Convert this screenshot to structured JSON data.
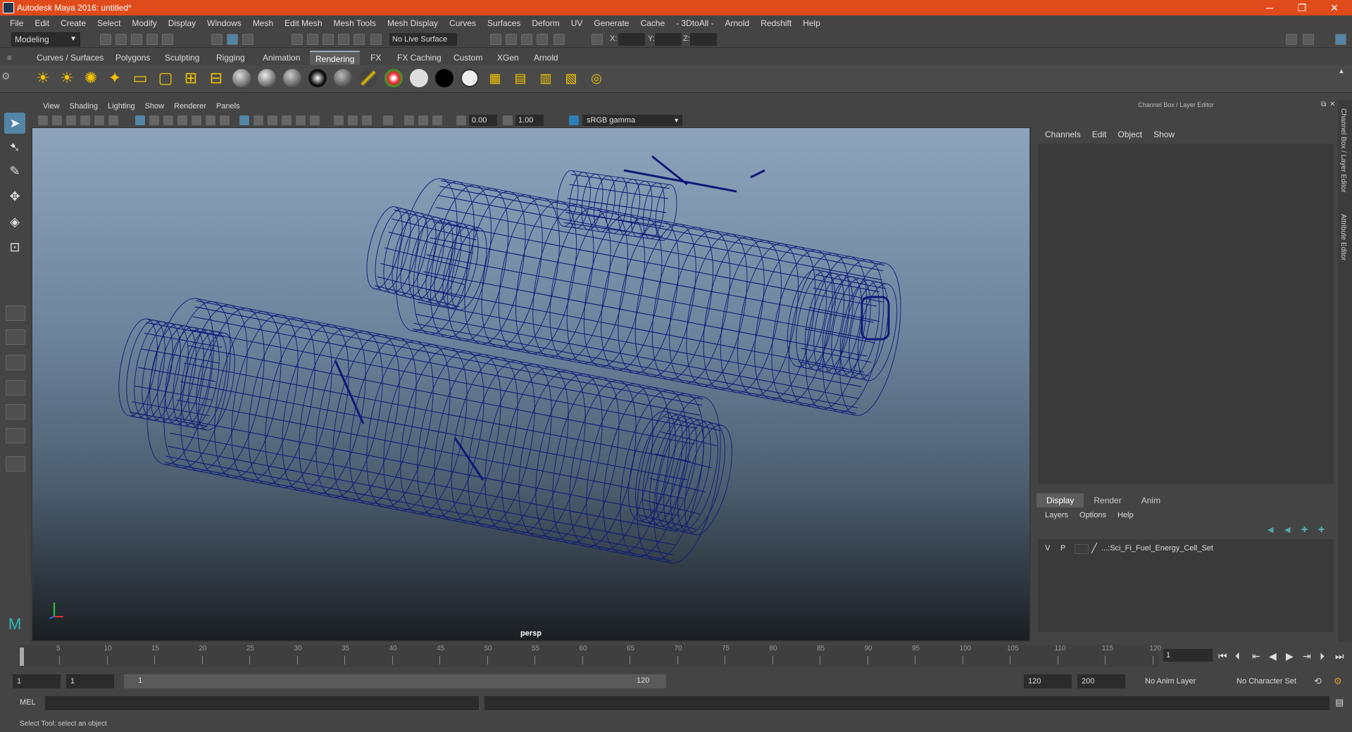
{
  "window": {
    "title": "Autodesk Maya 2016: untitled*",
    "min": "─",
    "max": "❐",
    "close": "✕"
  },
  "menubar": [
    "File",
    "Edit",
    "Create",
    "Select",
    "Modify",
    "Display",
    "Windows",
    "Mesh",
    "Edit Mesh",
    "Mesh Tools",
    "Mesh Display",
    "Curves",
    "Surfaces",
    "Deform",
    "UV",
    "Generate",
    "Cache",
    "- 3DtoAll -",
    "Arnold",
    "Redshift",
    "Help"
  ],
  "statusline": {
    "mode": "Modeling",
    "live_surface": "No Live Surface",
    "x": "X:",
    "y": "Y:",
    "z": "Z:"
  },
  "shelf_tabs": [
    "Curves / Surfaces",
    "Polygons",
    "Sculpting",
    "Rigging",
    "Animation",
    "Rendering",
    "FX",
    "FX Caching",
    "Custom",
    "XGen",
    "Arnold"
  ],
  "shelf_active": "Rendering",
  "panel_menu": [
    "View",
    "Shading",
    "Lighting",
    "Show",
    "Renderer",
    "Panels"
  ],
  "panel_toolbar": {
    "exposure": "0.00",
    "gamma": "1.00",
    "colorspace": "sRGB gamma"
  },
  "viewport": {
    "camera": "persp",
    "wire_color": "#0e1a78"
  },
  "channel_box": {
    "title": "Channel Box / Layer Editor",
    "menu": [
      "Channels",
      "Edit",
      "Object",
      "Show"
    ]
  },
  "layer_editor": {
    "tabs": [
      "Display",
      "Render",
      "Anim"
    ],
    "active_tab": "Display",
    "menu": [
      "Layers",
      "Options",
      "Help"
    ],
    "layers": [
      {
        "v": "V",
        "p": "P",
        "name": "...:Sci_Fi_Fuel_Energy_Cell_Set"
      }
    ]
  },
  "side_tabs": [
    "Channel Box / Layer Editor",
    "Attribute Editor"
  ],
  "timeslider": {
    "ticks": [
      "5",
      "10",
      "15",
      "20",
      "25",
      "30",
      "35",
      "40",
      "45",
      "50",
      "55",
      "60",
      "65",
      "70",
      "75",
      "80",
      "85",
      "90",
      "95",
      "100",
      "105",
      "110",
      "115",
      "120"
    ],
    "start_label": "1",
    "current_frame": "1"
  },
  "rangeslider": {
    "start": "1",
    "start2": "1",
    "bar_start": "1",
    "bar_end": "120",
    "end": "120",
    "end2": "200",
    "anim_layer": "No Anim Layer",
    "char_set": "No Character Set"
  },
  "cmdline": {
    "label": "MEL"
  },
  "helpline": {
    "text": "Select Tool: select an object"
  }
}
